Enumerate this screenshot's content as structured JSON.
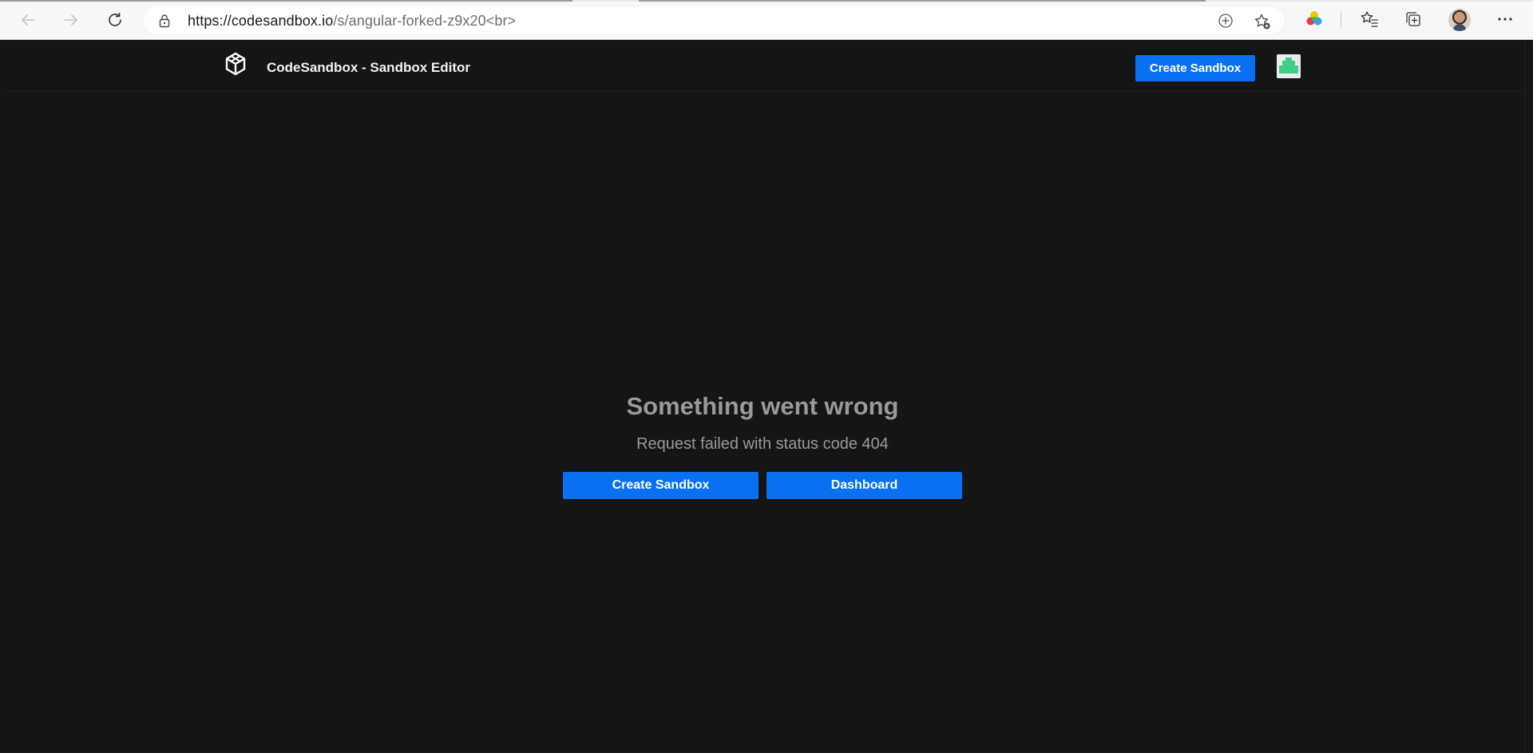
{
  "browser": {
    "url_host": "https://codesandbox.io",
    "url_path": "/s/angular-forked-z9x20<br>",
    "icons": {
      "back": "back-arrow-icon",
      "forward": "forward-arrow-icon",
      "refresh": "refresh-icon",
      "lock": "lock-icon",
      "add": "add-circle-icon",
      "favorite": "add-favorite-icon",
      "extension": "color-wheel-icon",
      "favorites": "favorites-list-icon",
      "collections": "collections-icon",
      "profile": "profile-avatar",
      "more": "more-ellipsis-icon"
    }
  },
  "header": {
    "title": "CodeSandbox - Sandbox Editor",
    "create_sandbox_label": "Create Sandbox"
  },
  "error": {
    "title": "Something went wrong",
    "message": "Request failed with status code 404",
    "create_sandbox_label": "Create Sandbox",
    "dashboard_label": "Dashboard"
  },
  "colors": {
    "background": "#151515",
    "accent": "#0971f1",
    "muted_text": "#9a9a9a",
    "avatar_green": "#3fd083"
  }
}
